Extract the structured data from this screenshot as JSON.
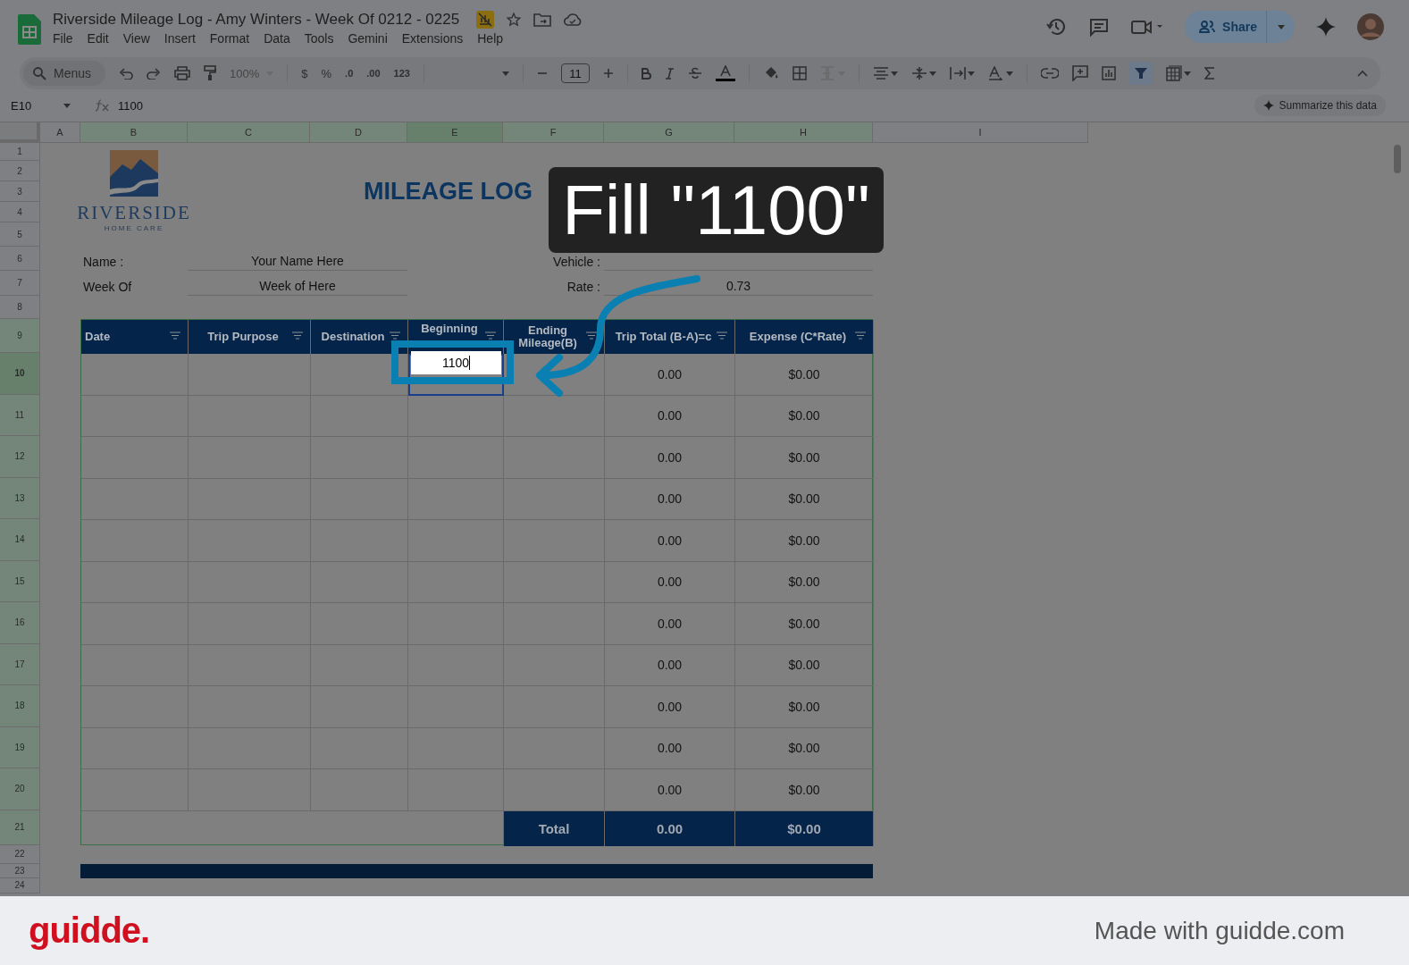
{
  "document": {
    "title": "Riverside Mileage Log - Amy Winters - Week Of 0212 - 0225"
  },
  "menus": [
    "File",
    "Edit",
    "View",
    "Insert",
    "Format",
    "Data",
    "Tools",
    "Gemini",
    "Extensions",
    "Help"
  ],
  "share": {
    "label": "Share"
  },
  "toolbar": {
    "search_placeholder": "Menus",
    "zoom": "100%",
    "currency": "$",
    "percent": "%",
    "decrease_decimals": ".0",
    "increase_decimals": ".00",
    "number_format": "123",
    "font_size": "11"
  },
  "formula_bar": {
    "cell_ref": "E10",
    "formula": "1100",
    "summarize": "Summarize this data"
  },
  "columns": [
    {
      "label": "A",
      "selected": false
    },
    {
      "label": "B",
      "selected": false
    },
    {
      "label": "C",
      "selected": false
    },
    {
      "label": "D",
      "selected": false
    },
    {
      "label": "E",
      "selected": true
    },
    {
      "label": "F",
      "selected": false
    },
    {
      "label": "G",
      "selected": false
    },
    {
      "label": "H",
      "selected": false
    },
    {
      "label": "I",
      "selected": false
    }
  ],
  "rows": [
    {
      "label": "1",
      "selected": false
    },
    {
      "label": "2",
      "selected": false
    },
    {
      "label": "3",
      "selected": false
    },
    {
      "label": "4",
      "selected": false
    },
    {
      "label": "5",
      "selected": false
    },
    {
      "label": "6",
      "selected": false
    },
    {
      "label": "7",
      "selected": false
    },
    {
      "label": "8",
      "selected": false
    },
    {
      "label": "9",
      "selected": false
    },
    {
      "label": "10",
      "selected": true
    },
    {
      "label": "11",
      "selected": false
    },
    {
      "label": "12",
      "selected": false
    },
    {
      "label": "13",
      "selected": false
    },
    {
      "label": "14",
      "selected": false
    },
    {
      "label": "15",
      "selected": false
    },
    {
      "label": "16",
      "selected": false
    },
    {
      "label": "17",
      "selected": false
    },
    {
      "label": "18",
      "selected": false
    },
    {
      "label": "19",
      "selected": false
    },
    {
      "label": "20",
      "selected": false
    },
    {
      "label": "21",
      "selected": false
    },
    {
      "label": "22",
      "selected": false
    },
    {
      "label": "23",
      "selected": false
    },
    {
      "label": "24",
      "selected": false
    }
  ],
  "logo": {
    "name": "RIVERSIDE",
    "tagline": "HOME CARE"
  },
  "sheet_title": "MILEAGE LOG",
  "fields": [
    {
      "label": "Name :",
      "value": "Your Name Here"
    },
    {
      "label": "Vehicle :"
    },
    {
      "label": "Week Of",
      "value": "Week of Here"
    },
    {
      "label": "Rate :",
      "value": "0.73"
    }
  ],
  "table": {
    "headers": [
      "Date",
      "Trip Purpose",
      "Destination",
      "Beginning",
      "Ending Mileage(B)",
      "Trip Total (B-A)=c",
      "Expense (C*Rate)"
    ],
    "rows": [
      {
        "beginning_mileage": "1100",
        "editing": true,
        "trip_total": "0.00",
        "expense": "$0.00"
      },
      {
        "editing": false,
        "trip_total": "0.00",
        "expense": "$0.00"
      },
      {
        "editing": false,
        "trip_total": "0.00",
        "expense": "$0.00"
      },
      {
        "editing": false,
        "trip_total": "0.00",
        "expense": "$0.00"
      },
      {
        "editing": false,
        "trip_total": "0.00",
        "expense": "$0.00"
      },
      {
        "editing": false,
        "trip_total": "0.00",
        "expense": "$0.00"
      },
      {
        "editing": false,
        "trip_total": "0.00",
        "expense": "$0.00"
      },
      {
        "editing": false,
        "trip_total": "0.00",
        "expense": "$0.00"
      },
      {
        "editing": false,
        "trip_total": "0.00",
        "expense": "$0.00"
      },
      {
        "editing": false,
        "trip_total": "0.00",
        "expense": "$0.00"
      },
      {
        "editing": false,
        "trip_total": "0.00",
        "expense": "$0.00"
      }
    ],
    "total": {
      "label": "Total",
      "trip_total": "0.00",
      "expense": "$0.00"
    }
  },
  "callout": {
    "text": "Fill \"1100\""
  },
  "footer": {
    "brand": "guidde.",
    "credit": "Made with guidde.com"
  }
}
